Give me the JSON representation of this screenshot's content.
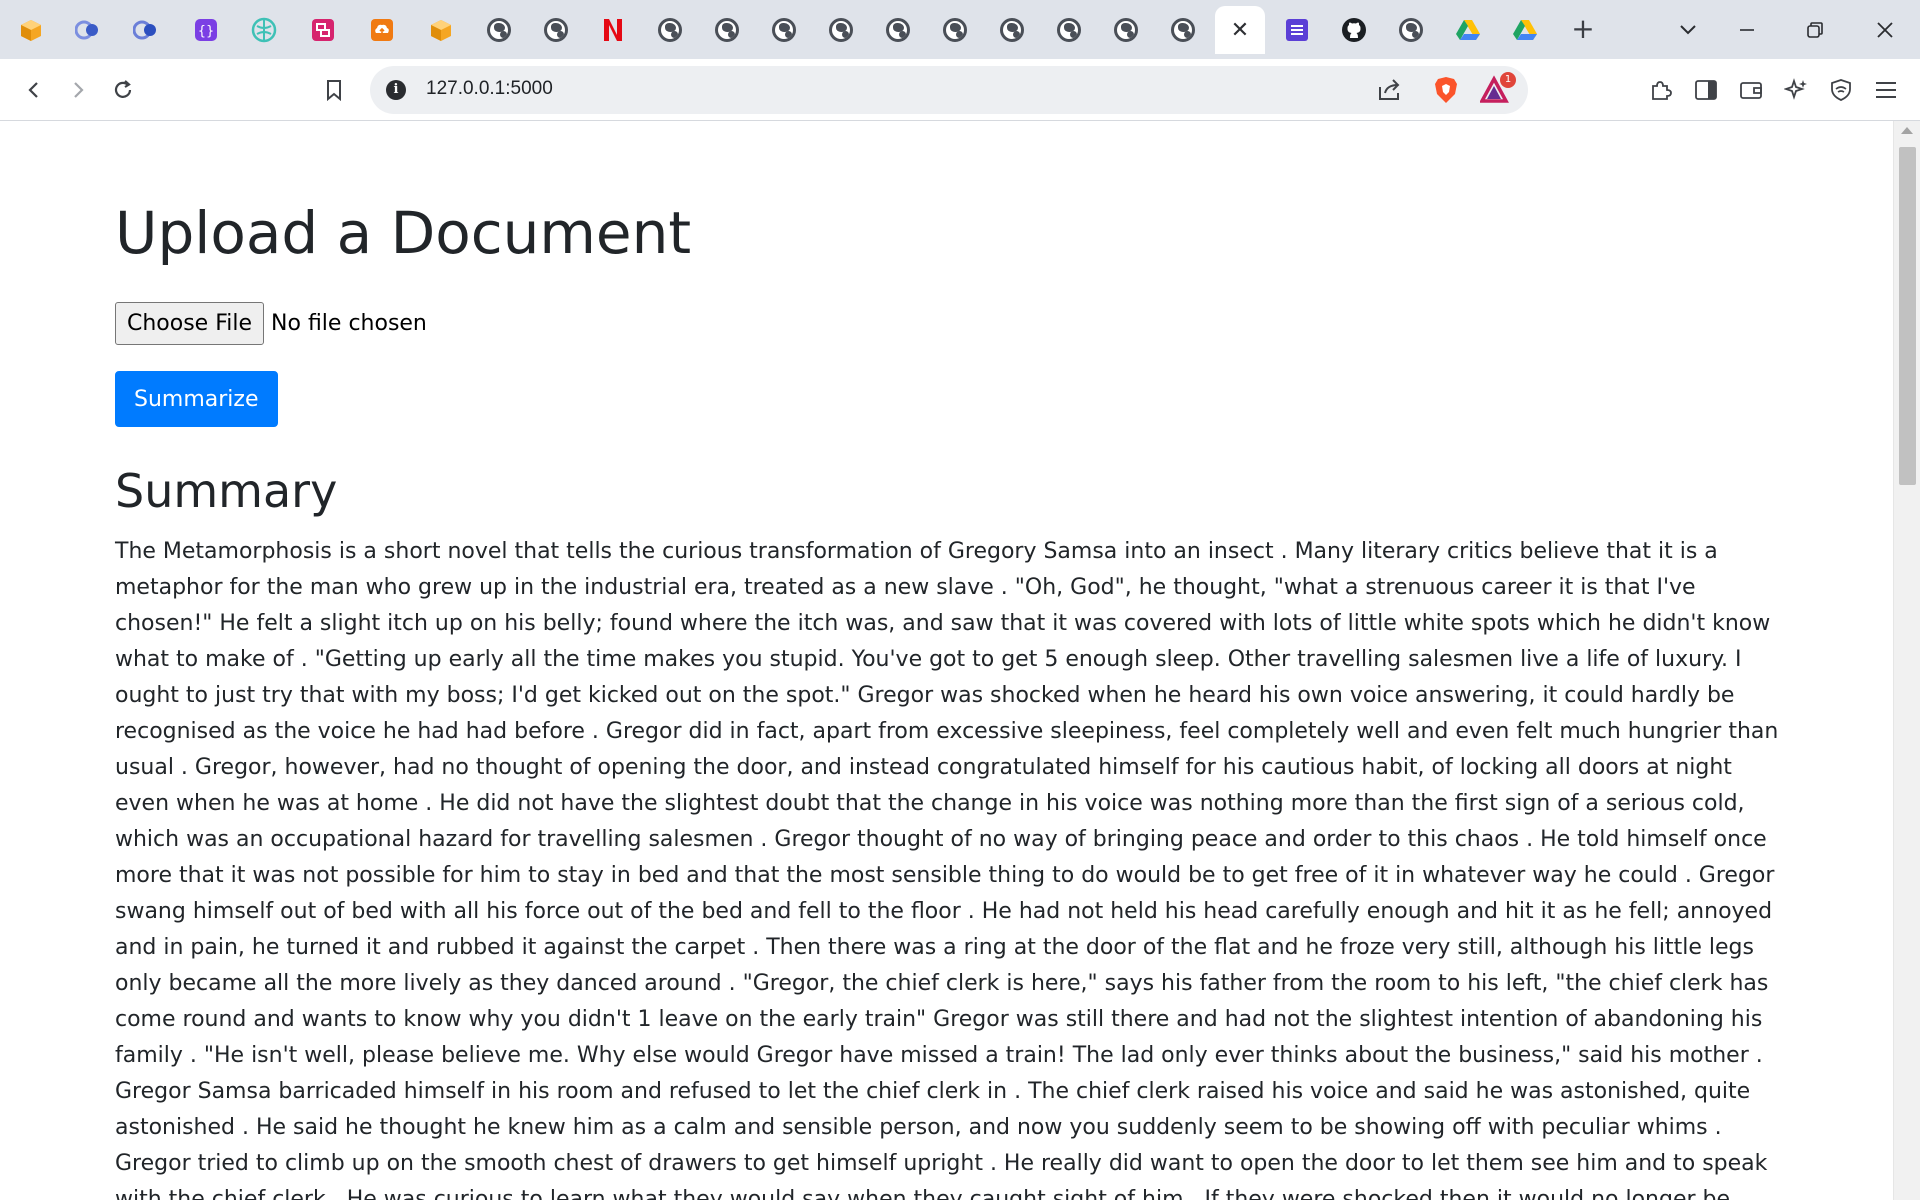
{
  "browser": {
    "tabs": [
      {
        "icon": "cube-icon",
        "color": "#f5a623"
      },
      {
        "icon": "circles-icon",
        "color": "#5b7fd6"
      },
      {
        "icon": "circles-icon",
        "color": "#4b6bd0"
      },
      {
        "icon": "bracket-icon",
        "color": "#7b3fe4"
      },
      {
        "icon": "brain-icon",
        "color": "#3ec1b6"
      },
      {
        "icon": "app-icon",
        "color": "#d6246e"
      },
      {
        "icon": "cloud-upload-icon",
        "color": "#f07a12"
      },
      {
        "icon": "cube-icon",
        "color": "#f5a623"
      },
      {
        "icon": "globe-icon",
        "color": "#4a4f57"
      },
      {
        "icon": "globe-icon",
        "color": "#4a4f57"
      },
      {
        "icon": "n-logo-icon",
        "color": "#e50914"
      },
      {
        "icon": "globe-icon",
        "color": "#4a4f57"
      },
      {
        "icon": "globe-icon",
        "color": "#4a4f57"
      },
      {
        "icon": "globe-icon",
        "color": "#4a4f57"
      },
      {
        "icon": "globe-icon",
        "color": "#4a4f57"
      },
      {
        "icon": "globe-icon",
        "color": "#4a4f57"
      },
      {
        "icon": "globe-icon",
        "color": "#4a4f57"
      },
      {
        "icon": "globe-icon",
        "color": "#4a4f57"
      },
      {
        "icon": "globe-icon",
        "color": "#4a4f57"
      },
      {
        "icon": "globe-icon",
        "color": "#4a4f57"
      },
      {
        "icon": "globe-icon",
        "color": "#4a4f57"
      },
      {
        "icon": "close-icon",
        "color": "#2d2f33",
        "active": true
      },
      {
        "icon": "list-icon",
        "color": "#5b3fd6"
      },
      {
        "icon": "github-icon",
        "color": "#1b1f23"
      },
      {
        "icon": "globe-icon",
        "color": "#4a4f57"
      },
      {
        "icon": "drive-icon",
        "color": "#1fa463"
      },
      {
        "icon": "drive-icon",
        "color": "#1fa463"
      }
    ],
    "address": "127.0.0.1:5000",
    "notification_count": "1",
    "colors": {
      "tabstrip": "#dfe3ea",
      "brave_orange": "#fb542b",
      "primary_button": "#007bff"
    }
  },
  "page": {
    "title": "Upload a Document",
    "file_input": {
      "button_label": "Choose File",
      "status": "No file chosen"
    },
    "submit_label": "Summarize",
    "summary_heading": "Summary",
    "summary_text": "The Metamorphosis is a short novel that tells the curious transformation of Gregory Samsa into an insect . Many literary critics believe that it is a metaphor for the man who grew up in the industrial era, treated as a new slave . \"Oh, God\", he thought, \"what a strenuous career it is that I've chosen!\" He felt a slight itch up on his belly; found where the itch was, and saw that it was covered with lots of little white spots which he didn't know what to make of . \"Getting up early all the time makes you stupid. You've got to get 5 enough sleep. Other travelling salesmen live a life of luxury. I ought to just try that with my boss; I'd get kicked out on the spot.\" Gregor was shocked when he heard his own voice answering, it could hardly be recognised as the voice he had had before . Gregor did in fact, apart from excessive sleepiness, feel completely well and even felt much hungrier than usual . Gregor, however, had no thought of opening the door, and instead congratulated himself for his cautious habit, of locking all doors at night even when he was at home . He did not have the slightest doubt that the change in his voice was nothing more than the first sign of a serious cold, which was an occupational hazard for travelling salesmen . Gregor thought of no way of bringing peace and order to this chaos . He told himself once more that it was not possible for him to stay in bed and that the most sensible thing to do would be to get free of it in whatever way he could . Gregor swang himself out of bed with all his force out of the bed and fell to the floor . He had not held his head carefully enough and hit it as he fell; annoyed and in pain, he turned it and rubbed it against the carpet . Then there was a ring at the door of the flat and he froze very still, although his little legs only became all the more lively as they danced around . \"Gregor, the chief clerk is here,\" says his father from the room to his left, \"the chief clerk has come round and wants to know why you didn't 1 leave on the early train\" Gregor was still there and had not the slightest intention of abandoning his family . \"He isn't well, please believe me. Why else would Gregor have missed a train! The lad only ever thinks about the business,\" said his mother . Gregor Samsa barricaded himself in his room and refused to let the chief clerk in . The chief clerk raised his voice and said he was astonished, quite astonished . He said he thought he knew him as a calm and sensible person, and now you suddenly seem to be showing off with peculiar whims . Gregor tried to climb up on the smooth chest of drawers to get himself upright . He really did want to open the door to let them see him and to speak with the chief clerk . He was curious to learn what they would say when they caught sight of him . If they were shocked then it would no longer be Gregor's responsibility and he could rest. But if they took everything calmly he would still have no reason to be upset . Gregor felt that"
  }
}
